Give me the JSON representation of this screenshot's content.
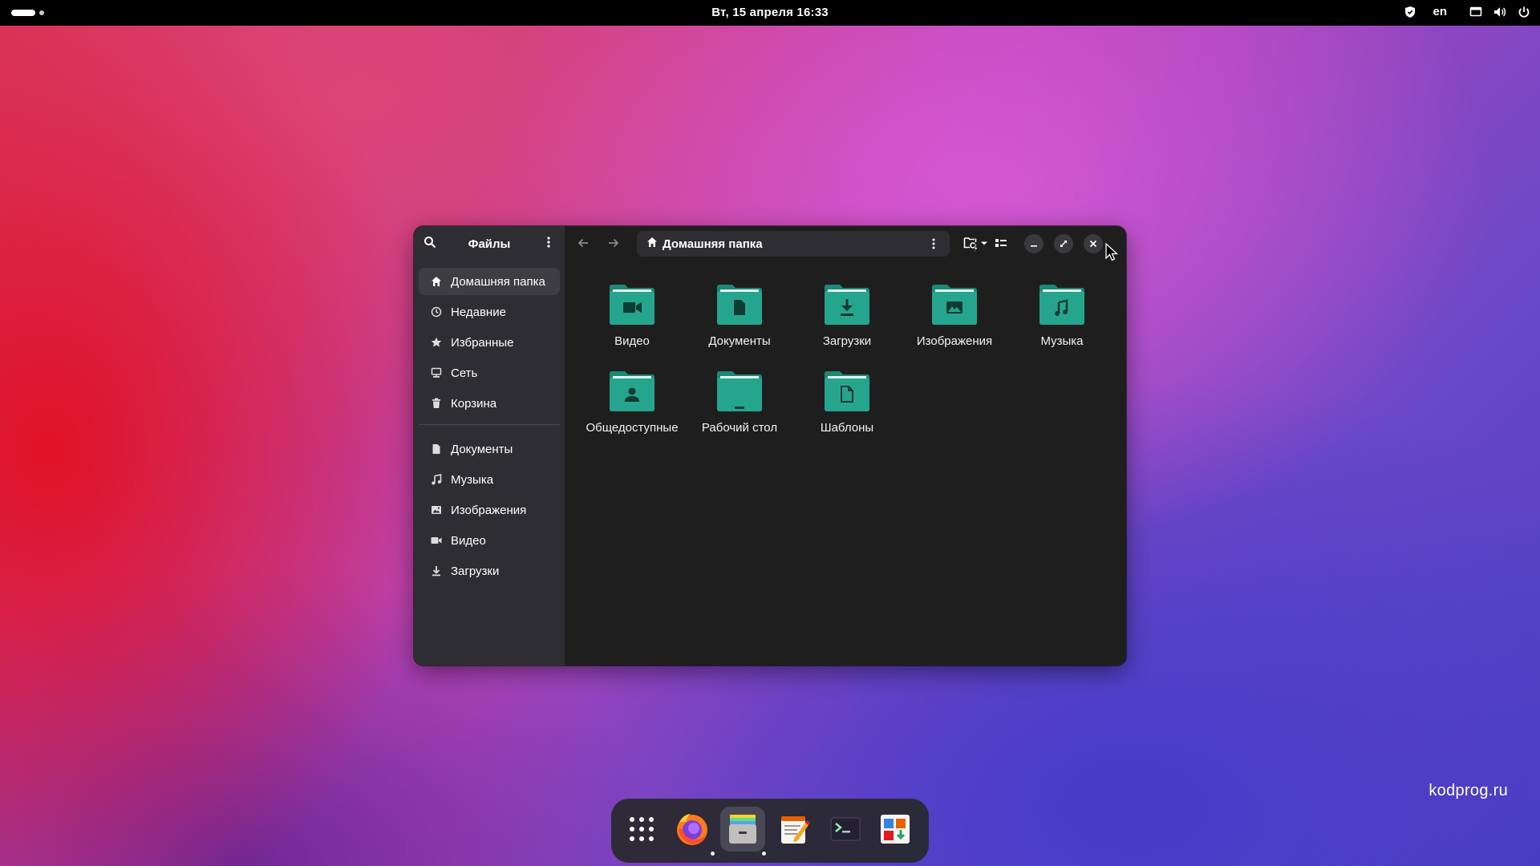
{
  "topbar": {
    "clock": "Вт, 15 апреля  16:33",
    "language": "en"
  },
  "window": {
    "app_title": "Файлы",
    "path": "Домашняя папка",
    "sidebar": {
      "places": [
        {
          "label": "Домашняя папка",
          "icon": "home-icon",
          "active": true
        },
        {
          "label": "Недавние",
          "icon": "clock-icon"
        },
        {
          "label": "Избранные",
          "icon": "star-icon"
        },
        {
          "label": "Сеть",
          "icon": "network-icon"
        },
        {
          "label": "Корзина",
          "icon": "trash-icon"
        }
      ],
      "bookmarks": [
        {
          "label": "Документы",
          "icon": "document-icon"
        },
        {
          "label": "Музыка",
          "icon": "music-icon"
        },
        {
          "label": "Изображения",
          "icon": "image-icon"
        },
        {
          "label": "Видео",
          "icon": "video-icon"
        },
        {
          "label": "Загрузки",
          "icon": "download-icon"
        }
      ]
    },
    "folders": [
      {
        "label": "Видео",
        "emblem": "video"
      },
      {
        "label": "Документы",
        "emblem": "document"
      },
      {
        "label": "Загрузки",
        "emblem": "download"
      },
      {
        "label": "Изображения",
        "emblem": "image"
      },
      {
        "label": "Музыка",
        "emblem": "music"
      },
      {
        "label": "Общедоступные",
        "emblem": "person"
      },
      {
        "label": "Рабочий стол",
        "emblem": "desktop"
      },
      {
        "label": "Шаблоны",
        "emblem": "template"
      }
    ]
  },
  "dock": {
    "items": [
      "apps-grid-icon",
      "firefox-icon",
      "files-icon",
      "text-editor-icon",
      "terminal-icon",
      "software-store-icon"
    ]
  },
  "watermark": "kodprog.ru",
  "colors": {
    "folder_teal": "#26a58e",
    "folder_tab": "#1b8a74",
    "window_bg": "#1e1e1e",
    "sidebar_bg": "#2e2e32"
  }
}
